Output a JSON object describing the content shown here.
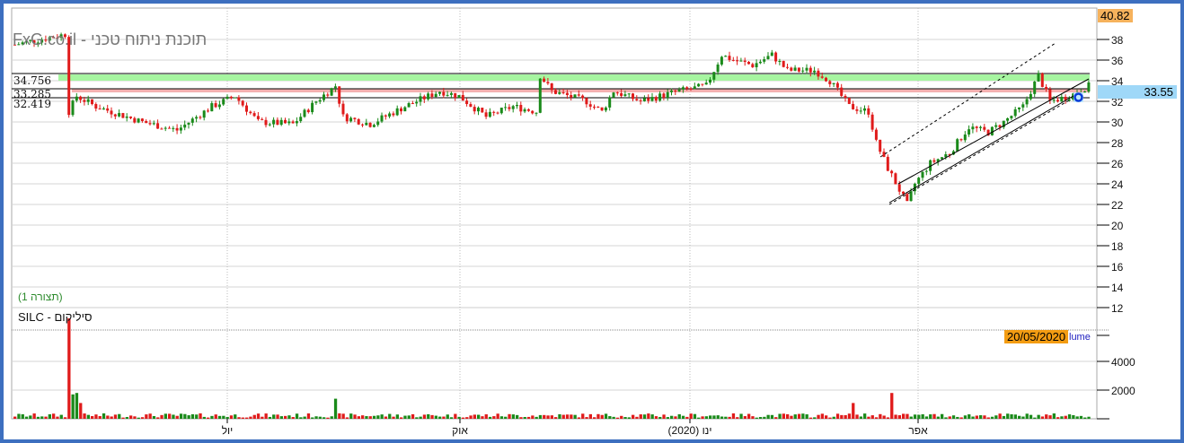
{
  "watermark": "FxG.co.il - תוכנת ניתוח טכני",
  "config_label": "(תצורה 1)",
  "symbol_label": "SILC - סיליקום",
  "price_max_label": "40.82",
  "current_price_label": "33.55",
  "date_label": "20/05/2020",
  "volume_label": "lume",
  "level_labels": [
    "34.756",
    "33.285",
    "32.419"
  ],
  "colors": {
    "up": "#1a8a1a",
    "down": "#e01b1b",
    "support_band": "#a6f5a0",
    "resistance_band": "#f4b0b0",
    "frame": "#3d6fbf"
  },
  "chart_data": {
    "type": "candlestick",
    "price_axis": {
      "min": 10,
      "max": 40,
      "ticks": [
        12,
        14,
        16,
        18,
        20,
        22,
        24,
        26,
        28,
        30,
        32,
        34,
        36,
        38
      ]
    },
    "volume_axis": {
      "min": 0,
      "max": 6000,
      "ticks": [
        2000,
        4000
      ]
    },
    "x_labels": [
      "יול",
      "אוק",
      "ינו (2020)",
      "אפר"
    ],
    "horizontal_levels": [
      34.756,
      33.285,
      32.419
    ],
    "close_path": [
      [
        0,
        37.5
      ],
      [
        13,
        38.5
      ],
      [
        14,
        31
      ],
      [
        16,
        32.5
      ],
      [
        21,
        31.5
      ],
      [
        33,
        30
      ],
      [
        42,
        29.2
      ],
      [
        51,
        31.5
      ],
      [
        57,
        32.5
      ],
      [
        63,
        30
      ],
      [
        72,
        29.8
      ],
      [
        78,
        32
      ],
      [
        83,
        33.5
      ],
      [
        85,
        30.5
      ],
      [
        92,
        29.8
      ],
      [
        101,
        31.5
      ],
      [
        110,
        33
      ],
      [
        115,
        32.5
      ],
      [
        122,
        30.5
      ],
      [
        129,
        31.5
      ],
      [
        135,
        31
      ],
      [
        136,
        34.5
      ],
      [
        139,
        33
      ],
      [
        148,
        32
      ],
      [
        152,
        31
      ],
      [
        155,
        33
      ],
      [
        162,
        32
      ],
      [
        172,
        33
      ],
      [
        179,
        33.5
      ],
      [
        183,
        36.5
      ],
      [
        186,
        36
      ],
      [
        191,
        35.5
      ],
      [
        196,
        36.5
      ],
      [
        200,
        35
      ],
      [
        207,
        35
      ],
      [
        211,
        34
      ],
      [
        216,
        31.5
      ],
      [
        221,
        31
      ],
      [
        223,
        28
      ],
      [
        226,
        25.5
      ],
      [
        231,
        22
      ],
      [
        233,
        24
      ],
      [
        237,
        26
      ],
      [
        242,
        27
      ],
      [
        247,
        29.5
      ],
      [
        252,
        29
      ],
      [
        256,
        30
      ],
      [
        261,
        31.5
      ],
      [
        265,
        34.5
      ],
      [
        268,
        32
      ],
      [
        273,
        32.5
      ],
      [
        278,
        33.5
      ]
    ],
    "volume_spikes": [
      [
        14,
        7000
      ],
      [
        15,
        1700
      ],
      [
        16,
        1800
      ],
      [
        17,
        1100
      ],
      [
        83,
        1400
      ],
      [
        217,
        1100
      ],
      [
        227,
        1800
      ]
    ]
  }
}
